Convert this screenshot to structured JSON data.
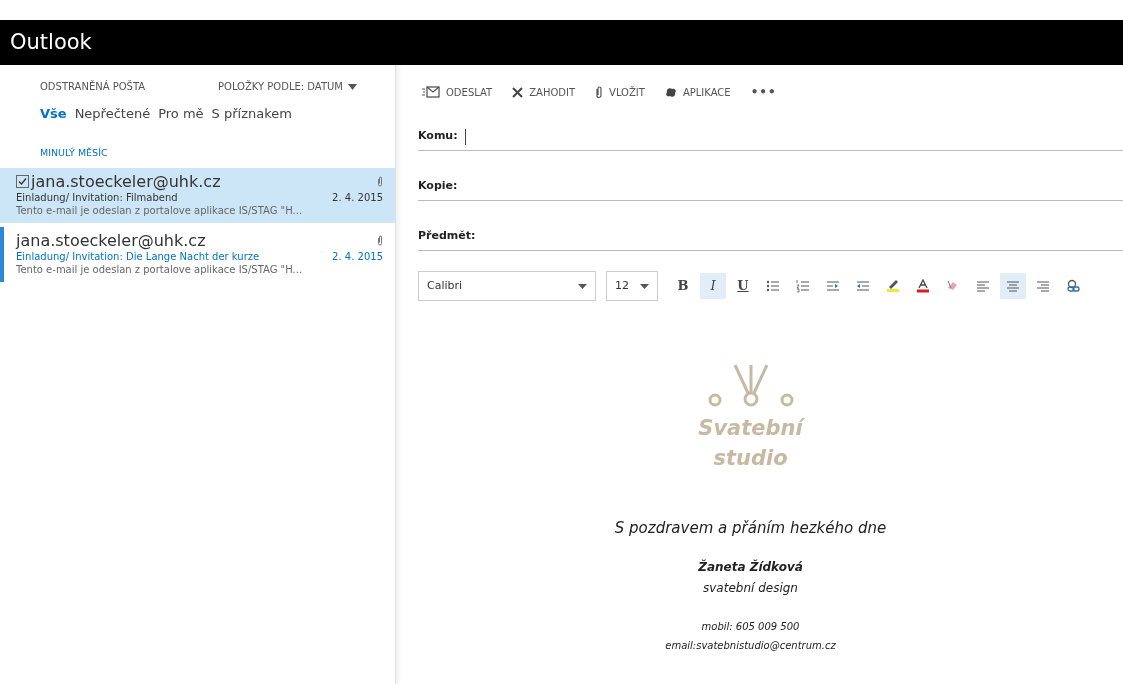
{
  "app_title": "Outlook",
  "folder_title": "ODSTRANĚNÁ POŠTA",
  "sort_label": "POLOŽKY PODLE: DATUM",
  "filters": [
    {
      "label": "Vše",
      "selected": true
    },
    {
      "label": "Nepřečtené",
      "selected": false
    },
    {
      "label": "Pro mě",
      "selected": false
    },
    {
      "label": "S příznakem",
      "selected": false
    }
  ],
  "group_label": "MINULÝ MĚSÍC",
  "messages": [
    {
      "sender": "jana.stoeckeler@uhk.cz",
      "subject": "Einladung/ Invitation: Filmabend",
      "date": "2. 4. 2015",
      "preview": "Tento e-mail je odeslan z portalove aplikace IS/STAG \"H...",
      "checked": true,
      "selected": true,
      "unread": false,
      "attachment": true
    },
    {
      "sender": "jana.stoeckeler@uhk.cz",
      "subject": "Einladung/ Invitation: Die Lange Nacht der kurze",
      "date": "2. 4. 2015",
      "preview": "Tento e-mail je odeslan z portalove aplikace IS/STAG \"H...",
      "checked": false,
      "selected": false,
      "unread": true,
      "attachment": true
    }
  ],
  "actions": [
    {
      "kind": "send",
      "label": "ODESLAT"
    },
    {
      "kind": "discard",
      "label": "ZAHODIT"
    },
    {
      "kind": "attach",
      "label": "VLOŽIT"
    },
    {
      "kind": "apps",
      "label": "APLIKACE"
    },
    {
      "kind": "more",
      "label": "•••"
    }
  ],
  "fields": [
    {
      "label": "Komu:",
      "focused": true
    },
    {
      "label": "Kopie:",
      "focused": false
    },
    {
      "label": "Předmět:",
      "focused": false
    }
  ],
  "font": "Calibri",
  "font_size": "12",
  "format_buttons": [
    {
      "kind": "bold",
      "label": "B",
      "active": false
    },
    {
      "kind": "italic",
      "label": "I",
      "active": true
    },
    {
      "kind": "underline",
      "label": "U",
      "active": false
    },
    {
      "kind": "bullets",
      "active": false
    },
    {
      "kind": "numbering",
      "active": false
    },
    {
      "kind": "indent",
      "active": false
    },
    {
      "kind": "outdent",
      "active": false
    },
    {
      "kind": "highlight",
      "active": false
    },
    {
      "kind": "fontcolor",
      "active": false
    },
    {
      "kind": "clear",
      "active": false
    },
    {
      "kind": "align-left",
      "active": false
    },
    {
      "kind": "align-center",
      "active": true
    },
    {
      "kind": "align-right",
      "active": false
    },
    {
      "kind": "link",
      "active": false
    }
  ],
  "signature": {
    "logo_lines": [
      "Svatební",
      "studio"
    ],
    "greeting": "S pozdravem a přáním hezkého dne",
    "name": "Žaneta Žídková",
    "role": "svatební design",
    "mobile": "mobil: 605 009 500",
    "email": "email:svatebnistudio@centrum.cz"
  }
}
